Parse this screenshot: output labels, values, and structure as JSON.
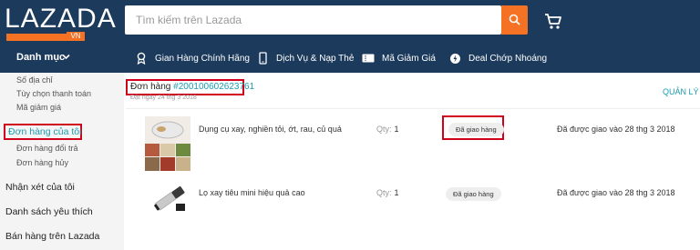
{
  "header": {
    "logo": "LAZADA",
    "logo_suffix": "VN",
    "search_placeholder": "Tìm kiếm trên Lazada",
    "category_label": "Danh mục",
    "nav": [
      {
        "label": "Gian Hàng Chính Hãng",
        "icon": "award-icon"
      },
      {
        "label": "Dịch Vụ & Nạp Thẻ",
        "icon": "phone-icon"
      },
      {
        "label": "Mã Giảm Giá",
        "icon": "ticket-icon"
      },
      {
        "label": "Deal Chớp Nhoáng",
        "icon": "flash-deal-icon"
      }
    ]
  },
  "sidebar": {
    "sub_top": [
      "Số địa chỉ",
      "Tùy chọn thanh toán",
      "Mã giảm giá"
    ],
    "active": "Đơn hàng của tôi",
    "sub_orders": [
      "Đơn hàng đổi trả",
      "Đơn hàng hủy"
    ],
    "main": [
      "Nhận xét của tôi",
      "Danh sách yêu thích",
      "Bán hàng trên Lazada"
    ]
  },
  "order": {
    "label": "Đơn hàng",
    "number": "#200100602623761",
    "date": "Đặt ngày 24 thg 3 2018",
    "manage": "QUẢN LÝ"
  },
  "items": [
    {
      "name": "Dụng cụ xay, nghiền tỏi, ớt, rau, củ quả",
      "qty_label": "Qty:",
      "qty": "1",
      "status": "Đã giao hàng",
      "delivered": "Đã được giao vào 28 thg 3 2018"
    },
    {
      "name": "Lọ xay tiêu mini hiệu quả cao",
      "qty_label": "Qty:",
      "qty": "1",
      "status": "Đã giao hàng",
      "delivered": "Đã được giao vào 28 thg 3 2018"
    }
  ],
  "colors": {
    "header_bg": "#1c3a5c",
    "accent": "#f57224",
    "link": "#1a9cb0",
    "highlight_border": "#d0021b"
  }
}
